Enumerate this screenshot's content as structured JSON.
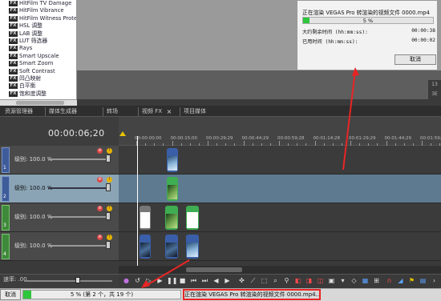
{
  "fx_list": [
    "HitFilm TV Damage",
    "HitFilm Vibrance",
    "HitFilm Witness Protection",
    "HSL 调整",
    "LAB 调整",
    "LUT 筛选器",
    "Rays",
    "Smart Upscale",
    "Smart Zoom",
    "Soft Contrast",
    "凹凸映射",
    "白平衡",
    "饱和度调整"
  ],
  "fx_icon_label": "FX",
  "dock_tabs": [
    "资源管理器",
    "媒体生成器",
    "转场",
    "视频 FX",
    "项目媒体"
  ],
  "right_edge_text": [
    "13",
    "3E"
  ],
  "render_dialog": {
    "title": "正在渲染 VEGAS Pro 转渲染的视频文件 0000.mp4",
    "progress_text": "5 %",
    "progress_value": 5,
    "remaining_label": "大约剩余时间 (hh:mm:ss):",
    "remaining_value": "00:00:38",
    "elapsed_label": "已用时间 (hh:mm:ss):",
    "elapsed_value": "00:00:02",
    "cancel_label": "取消"
  },
  "timeline": {
    "timecode": "00:00:06;20",
    "ruler_labels": [
      "00:00:00;00",
      "00:00:15;00",
      "00:00:29;29",
      "00:00:44;29",
      "00:00:59;28",
      "00:01:14;28",
      "00:01:29;29",
      "00:01:44;29",
      "00:01:59;28"
    ]
  },
  "tracks": [
    {
      "number": "1",
      "label": "级别: 100.0 %",
      "selected": false
    },
    {
      "number": "2",
      "label": "级别: 100.0 %",
      "selected": true
    },
    {
      "number": "3",
      "label": "级别: 100.0 %",
      "selected": false
    },
    {
      "number": "4",
      "label": "级别: 100.0 %",
      "selected": false
    }
  ],
  "rate_label": "速率: .00",
  "status_bar": {
    "cancel_label": "取消",
    "progress_text": "5 % (第 2 个，共 19 个)",
    "progress_value": 5,
    "message": "正在渲染 VEGAS Pro 转渲染的视频文件 0000.mp4..."
  },
  "colors": {
    "progress_green": "#2ec63c",
    "annotation_red": "#e82525"
  }
}
